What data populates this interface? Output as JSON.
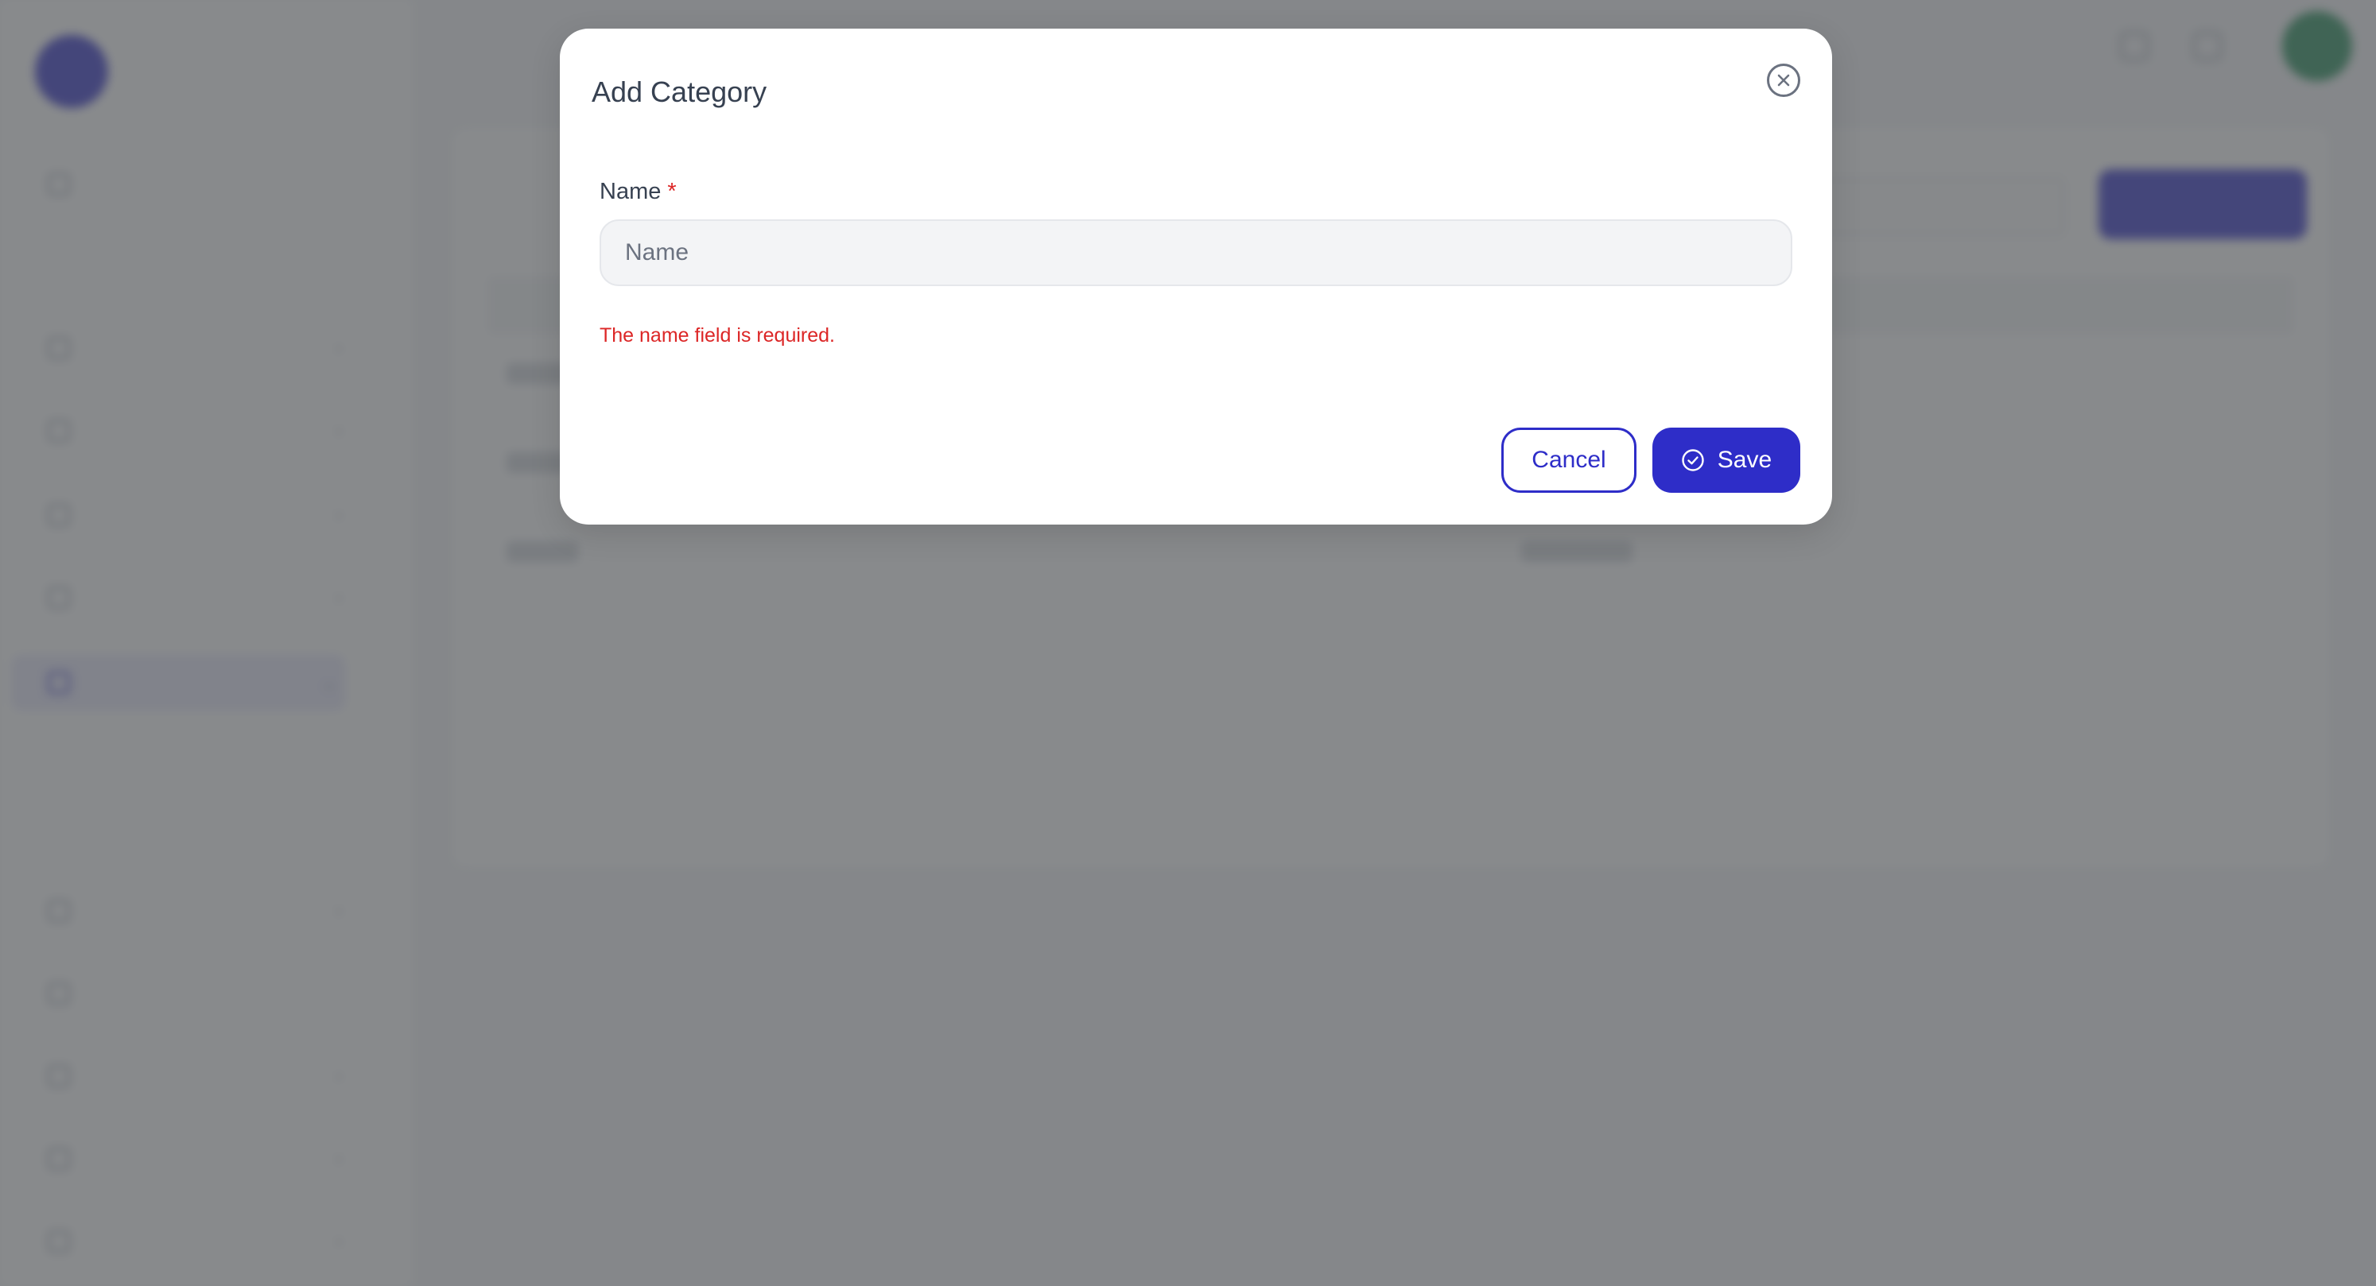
{
  "modal": {
    "title": "Add Category",
    "close_icon": "close-circle-icon",
    "fields": {
      "name": {
        "label": "Name",
        "required_marker": "*",
        "placeholder": "Name",
        "value": "",
        "error": "The name field is required."
      }
    },
    "buttons": {
      "cancel_label": "Cancel",
      "save_label": "Save",
      "save_icon": "check-circle-icon"
    }
  },
  "colors": {
    "primary": "#2e2dc8",
    "error": "#dc2626",
    "overlay": "#505256",
    "input_bg": "#f3f4f6",
    "text": "#374151"
  }
}
